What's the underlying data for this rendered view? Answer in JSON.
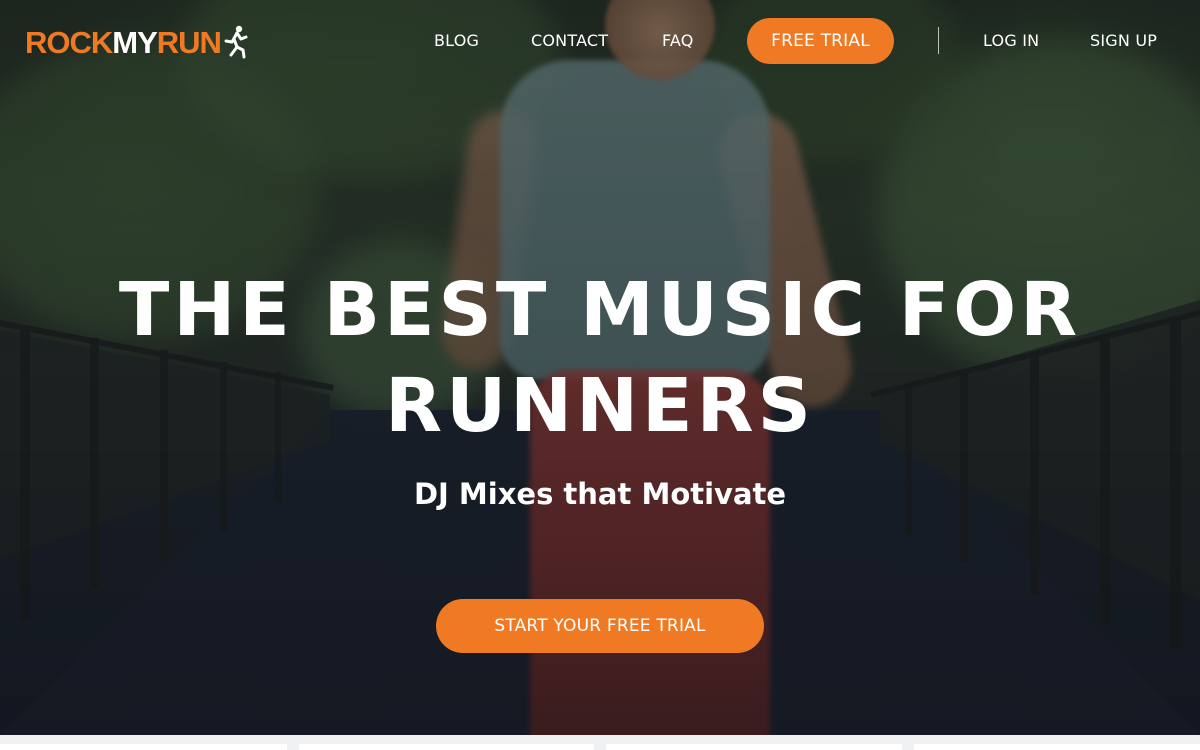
{
  "brand": {
    "logo_rock": "ROCK",
    "logo_my": "MY",
    "logo_run": "RUN",
    "accent_color": "#f07a24"
  },
  "nav": {
    "links": [
      {
        "label": "BLOG"
      },
      {
        "label": "CONTACT"
      },
      {
        "label": "FAQ"
      }
    ],
    "cta_label": "FREE TRIAL",
    "login_label": "LOG IN",
    "signup_label": "SIGN UP"
  },
  "hero": {
    "headline_line1": "THE BEST MUSIC FOR",
    "headline_line2": "RUNNERS",
    "subheadline": "DJ Mixes that Motivate",
    "cta_label": "START YOUR FREE TRIAL"
  },
  "icons": {
    "logo_icon": "running-person-icon"
  }
}
